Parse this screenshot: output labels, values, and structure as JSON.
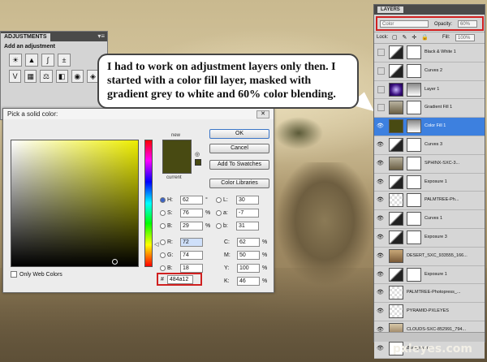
{
  "adjustments": {
    "tab": "ADJUSTMENTS",
    "subtitle": "Add an adjustment",
    "icons_row1": [
      "brightness-icon",
      "levels-icon",
      "curves-icon",
      "exposure-icon"
    ],
    "icons_row2": [
      "vibrance-icon",
      "hue-icon",
      "balance-icon",
      "bw-icon",
      "photofilter-icon",
      "mixer-icon"
    ]
  },
  "picker": {
    "title": "Pick a solid color:",
    "new_label": "new",
    "current_label": "current",
    "color": "#484a12",
    "buttons": {
      "ok": "OK",
      "cancel": "Cancel",
      "swatches": "Add To Swatches",
      "libraries": "Color Libraries"
    },
    "fields_left": [
      {
        "name": "H:",
        "value": "62",
        "unit": "°",
        "selected": true
      },
      {
        "name": "S:",
        "value": "76",
        "unit": "%",
        "selected": false
      },
      {
        "name": "B:",
        "value": "29",
        "unit": "%",
        "selected": false
      },
      {
        "name": "R:",
        "value": "72",
        "unit": "",
        "selected": false
      },
      {
        "name": "G:",
        "value": "74",
        "unit": "",
        "selected": false
      },
      {
        "name": "B:",
        "value": "18",
        "unit": "",
        "selected": false
      }
    ],
    "fields_right": [
      {
        "name": "L:",
        "value": "30",
        "unit": ""
      },
      {
        "name": "a:",
        "value": "-7",
        "unit": ""
      },
      {
        "name": "b:",
        "value": "31",
        "unit": ""
      },
      {
        "name": "C:",
        "value": "62",
        "unit": "%"
      },
      {
        "name": "M:",
        "value": "50",
        "unit": "%"
      },
      {
        "name": "Y:",
        "value": "100",
        "unit": "%"
      },
      {
        "name": "K:",
        "value": "46",
        "unit": "%"
      }
    ],
    "hex_label": "#",
    "hex_value": "484a12",
    "web_colors": "Only Web Colors"
  },
  "bubble": {
    "text": "I had to work on adjustment layers only then. I started with a color fill layer, masked with gradient grey to white and 60% color blending."
  },
  "layers": {
    "tab": "LAYERS",
    "blend_mode": "Color",
    "opacity_label": "Opacity:",
    "opacity": "60%",
    "lock_label": "Lock:",
    "fill_label": "Fill:",
    "fill": "100%",
    "items": [
      {
        "name": "Black & White 1",
        "thumb": "adj",
        "mask": true,
        "visible": false,
        "selected": false
      },
      {
        "name": "Curves 2",
        "thumb": "adj",
        "mask": true,
        "visible": false,
        "selected": false
      },
      {
        "name": "Layer 1",
        "thumb": "purple",
        "mask": true,
        "visible": false,
        "selected": false
      },
      {
        "name": "Gradient Fill 1",
        "thumb": "scene",
        "mask": true,
        "visible": false,
        "selected": false
      },
      {
        "name": "Color Fill 1",
        "thumb": "olive",
        "mask": true,
        "visible": true,
        "selected": true
      },
      {
        "name": "Curves 3",
        "thumb": "adj",
        "mask": true,
        "visible": true,
        "selected": false
      },
      {
        "name": "SPHINX-SXC-3...",
        "thumb": "scene",
        "mask": true,
        "visible": true,
        "selected": false
      },
      {
        "name": "Exposure 1",
        "thumb": "adj",
        "mask": true,
        "visible": true,
        "selected": false
      },
      {
        "name": "PALMTREE-Ph...",
        "thumb": "trans",
        "mask": true,
        "visible": true,
        "selected": false
      },
      {
        "name": "Curves 1",
        "thumb": "adj",
        "mask": true,
        "visible": true,
        "selected": false
      },
      {
        "name": "Exposure 3",
        "thumb": "adj",
        "mask": true,
        "visible": true,
        "selected": false
      },
      {
        "name": "DESERT_SXC_933555_166...",
        "thumb": "desert",
        "mask": false,
        "visible": true,
        "selected": false
      },
      {
        "name": "Exposure 1",
        "thumb": "adj",
        "mask": true,
        "visible": true,
        "selected": false
      },
      {
        "name": "PALMTREE-Photopress_...",
        "thumb": "trans",
        "mask": false,
        "visible": true,
        "selected": false
      },
      {
        "name": "PYRAMID-PXLEYES",
        "thumb": "trans",
        "mask": false,
        "visible": true,
        "selected": false
      },
      {
        "name": "CLOUDS-SXC-852991_794...",
        "thumb": "clouds",
        "mask": false,
        "visible": true,
        "selected": false
      },
      {
        "name": "Background",
        "thumb": "white",
        "mask": false,
        "visible": true,
        "selected": false
      }
    ]
  },
  "watermark": "pxleyes.com"
}
